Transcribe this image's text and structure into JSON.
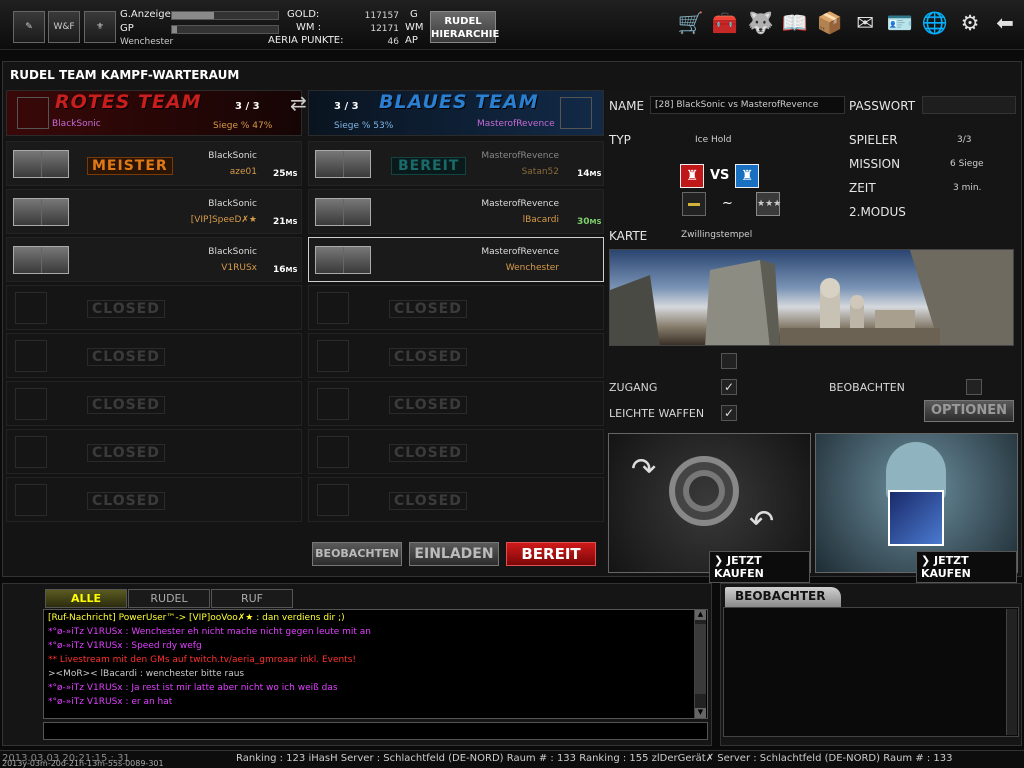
{
  "topbar": {
    "g_anzeige": "G.Anzeige",
    "gp": "GP",
    "player_name": "Wenchester",
    "gold_label": "GOLD:",
    "gold_value": "117157",
    "gold_unit": "G",
    "wm_label": "WM :",
    "wm_value": "12171",
    "wm_unit": "WM",
    "aeria_label": "AERIA PUNKTE:",
    "aeria_value": "46",
    "aeria_unit": "AP",
    "rudel_btn_line1": "RUDEL",
    "rudel_btn_line2": "HIERARCHIE",
    "g_bar_fill": 0.4,
    "gp_bar_fill": 0.05
  },
  "main": {
    "title": "RUDEL TEAM KAMPF-WARTERAUM"
  },
  "red_team": {
    "name": "ROTES TEAM",
    "count": "3 / 3",
    "leader": "BlackSonic",
    "win": "Siege % 47%"
  },
  "blue_team": {
    "name": "BLAUES TEAM",
    "count": "3 / 3",
    "leader": "MasterofRevence",
    "win": "Siege % 53%"
  },
  "red_slots": [
    {
      "name": "BlackSonic",
      "clan": "aze01",
      "ping": "25",
      "unit": "MS",
      "status": "MEISTER"
    },
    {
      "name": "BlackSonic",
      "clan": "[VIP]SpeeD✗★",
      "ping": "21",
      "unit": "MS",
      "status": ""
    },
    {
      "name": "BlackSonic",
      "clan": "V1RUSx",
      "ping": "16",
      "unit": "MS",
      "status": ""
    }
  ],
  "blue_slots": [
    {
      "name": "MasterofRevence",
      "clan": "Satan52",
      "ping": "14",
      "unit": "MS",
      "status": "BEREIT"
    },
    {
      "name": "MasterofRevence",
      "clan": "lBacardi",
      "ping": "30",
      "unit": "MS",
      "status": ""
    },
    {
      "name": "MasterofRevence",
      "clan": "Wenchester",
      "ping": "",
      "unit": "",
      "status": ""
    }
  ],
  "closed_label": "CLOSED",
  "actions": {
    "beobachten": "BEOBACHTEN",
    "einladen": "EINLADEN",
    "bereit": "BEREIT"
  },
  "room": {
    "name_label": "NAME",
    "name_value": "[28] BlackSonic vs MasterofRevence",
    "passwort_label": "PASSWORT",
    "typ_label": "TYP",
    "typ_value": "Ice Hold",
    "spieler_label": "SPIELER",
    "spieler_value": "3/3",
    "mission_label": "MISSION",
    "mission_value": "6 Siege",
    "zeit_label": "ZEIT",
    "zeit_value": "3 min.",
    "modus_label": "2.MODUS",
    "vs": "VS",
    "tilde": "~",
    "karte_label": "KARTE",
    "karte_value": "Zwillingstempel",
    "zugang_label": "ZUGANG",
    "leichte_label": "LEICHTE WAFFEN",
    "beobachten_label": "BEOBACHTEN",
    "optionen": "OPTIONEN",
    "buy1": "JETZT KAUFEN",
    "buy2": "JETZT KAUFEN"
  },
  "chat": {
    "tabs": [
      "ALLE",
      "RUDEL",
      "RUF"
    ],
    "lines": [
      {
        "text": "[Ruf-Nachricht]  PowerUser™-> [VIP]ooVoo✗★  : dan verdiens dir ;)",
        "color": "#ffff33"
      },
      {
        "text": "*°ø-»iTz V1RUSx  : Wenchester eh nicht mache nicht gegen leute mit an",
        "color": "#e040ff"
      },
      {
        "text": "*°ø-»iTz V1RUSx  : Speed rdy wefg",
        "color": "#e040ff"
      },
      {
        "text": "**  Livestream mit den GMs auf twitch.tv/aeria_gmroaar inkl. Events!",
        "color": "#ff3030"
      },
      {
        "text": "><MoR><  lBacardi  : wenchester bitte raus",
        "color": "#cccccc"
      },
      {
        "text": "*°ø-»iTz V1RUSx  : Ja rest ist mir latte aber nicht wo ich weiß das",
        "color": "#e040ff"
      },
      {
        "text": "*°ø-»iTz V1RUSx  : er an  hat",
        "color": "#e040ff"
      }
    ]
  },
  "beobachter": {
    "title": "BEOBACHTER"
  },
  "ticker": {
    "text": "Ranking : 123 iHasH Server : Schlachtfeld (DE-NORD) Raum # : 133          Ranking : 155 zlDerGerät✗ Server : Schlachtfeld (DE-NORD) Raum # : 133",
    "left": "2013.03.03 20:21:15 : 31",
    "stamp": "2013y-03m-20d-21h-13m-55s-0089-301"
  }
}
